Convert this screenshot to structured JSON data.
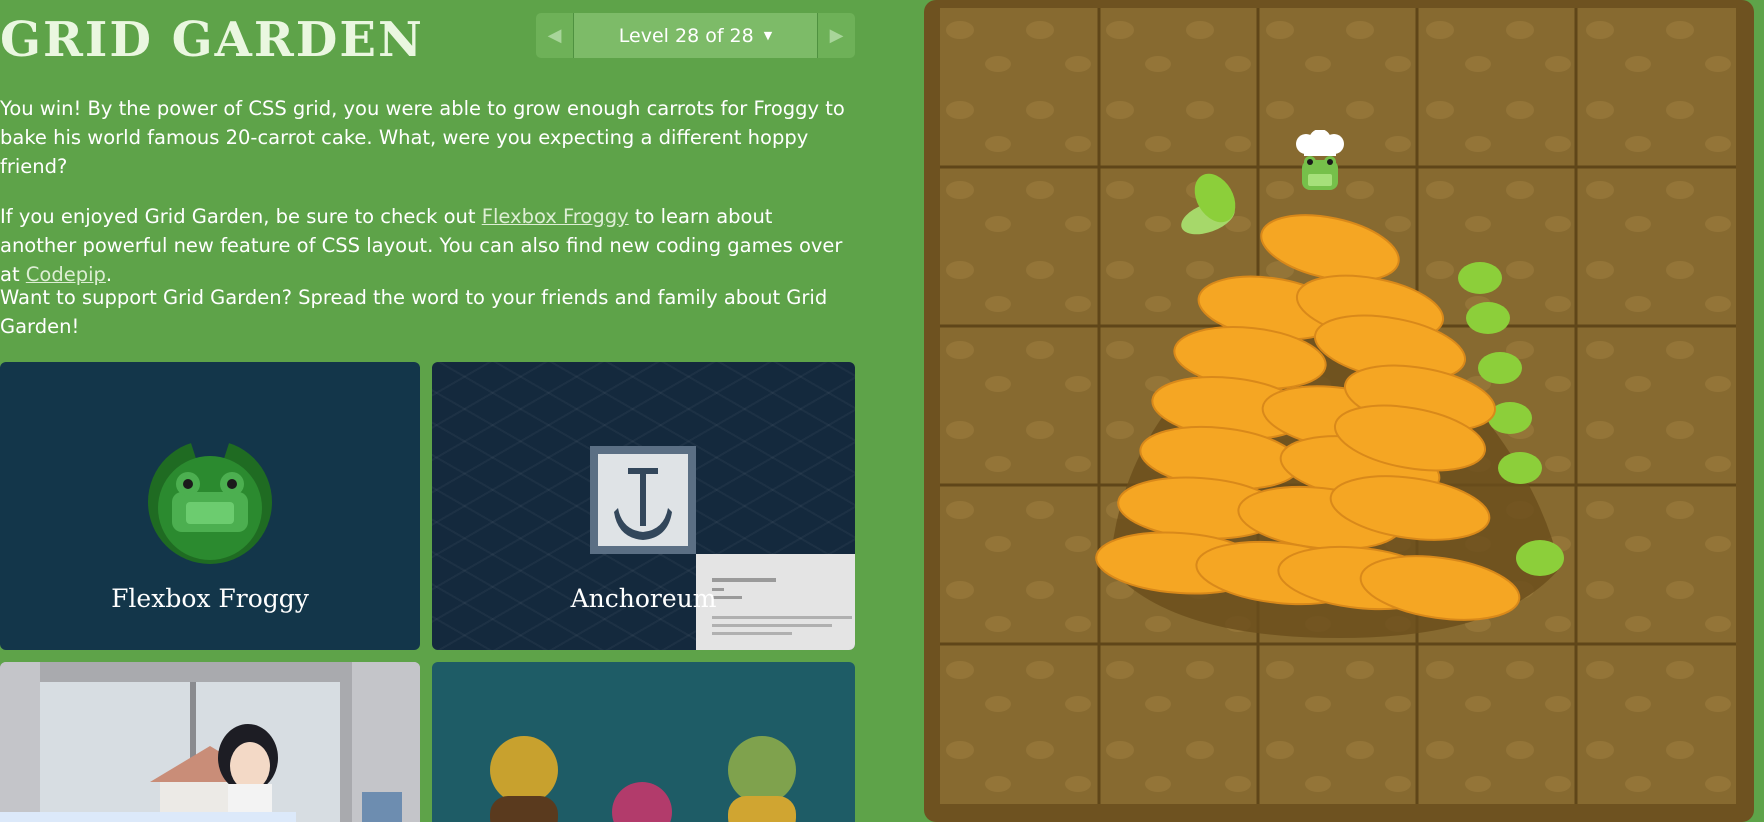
{
  "header": {
    "title": "GRID GARDEN",
    "level_label": "Level 28 of 28",
    "prev_icon": "triangle-left-icon",
    "next_icon": "triangle-right-icon",
    "dropdown_icon": "caret-down-icon"
  },
  "content": {
    "p1": "You win! By the power of CSS grid, you were able to grow enough carrots for Froggy to bake his world famous 20-carrot cake. What, were you expecting a different hoppy friend?",
    "p2_before": "If you enjoyed Grid Garden, be sure to check out ",
    "p2_link1": "Flexbox Froggy",
    "p2_middle": " to learn about another powerful new feature of CSS layout. You can also find new coding games over at ",
    "p2_link2": "Codepip",
    "p2_after": ".",
    "p3": "Want to support Grid Garden? Spread the word to your friends and family about Grid Garden!"
  },
  "games": [
    {
      "label": "Flexbox Froggy",
      "icon": "frog-lilypad-icon"
    },
    {
      "label": "Anchoreum",
      "icon": "anchor-icon"
    },
    {
      "label": "",
      "icon": "anime-girl-illustration"
    },
    {
      "label": "",
      "icon": "three-characters-illustration"
    }
  ],
  "board": {
    "columns": 5,
    "rows": 5,
    "colors": {
      "frame": "#6e5220",
      "soil": "#876a30",
      "grid_lines": "#5f4619",
      "carrot": "#f5a623",
      "leaf": "#8ccf3a"
    },
    "sprites": [
      "frog-chef-icon",
      "carrot-pile-icon"
    ]
  },
  "colors": {
    "background": "#5ea349",
    "nav": "#7dbb68"
  }
}
